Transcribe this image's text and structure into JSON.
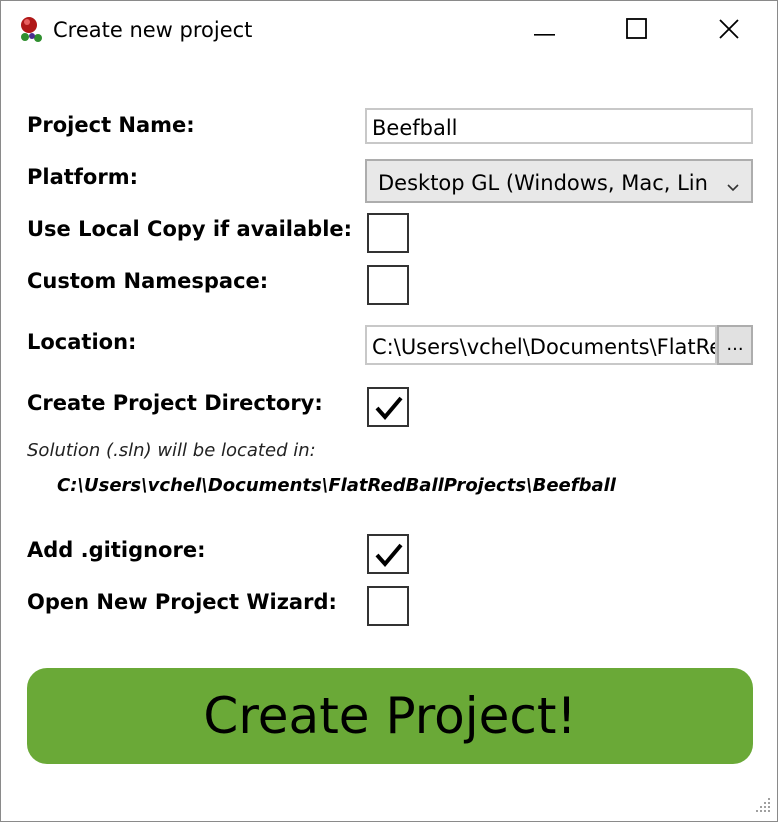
{
  "window": {
    "title": "Create new project"
  },
  "titlebar_buttons": {
    "minimize_icon": "minimize-icon",
    "maximize_icon": "maximize-icon",
    "close_icon": "close-icon"
  },
  "form": {
    "project_name": {
      "label": "Project Name:",
      "value": "Beefball"
    },
    "platform": {
      "label": "Platform:",
      "selected": "Desktop GL (Windows, Mac, Lin"
    },
    "use_local_copy": {
      "label": "Use Local Copy if available:",
      "checked": false
    },
    "custom_namespace": {
      "label": "Custom Namespace:",
      "checked": false
    },
    "location": {
      "label": "Location:",
      "value": "C:\\Users\\vchel\\Documents\\FlatRe",
      "browse_label": "..."
    },
    "create_project_directory": {
      "label": "Create Project Directory:",
      "checked": true
    },
    "solution_note": "Solution (.sln) will be located in:",
    "solution_path": "C:\\Users\\vchel\\Documents\\FlatRedBallProjects\\Beefball",
    "add_gitignore": {
      "label": "Add .gitignore:",
      "checked": true
    },
    "open_wizard": {
      "label": "Open New Project Wizard:",
      "checked": false
    }
  },
  "create_button": {
    "label": "Create Project!"
  },
  "colors": {
    "create_button": "#6aa937",
    "border": "#adadad"
  }
}
